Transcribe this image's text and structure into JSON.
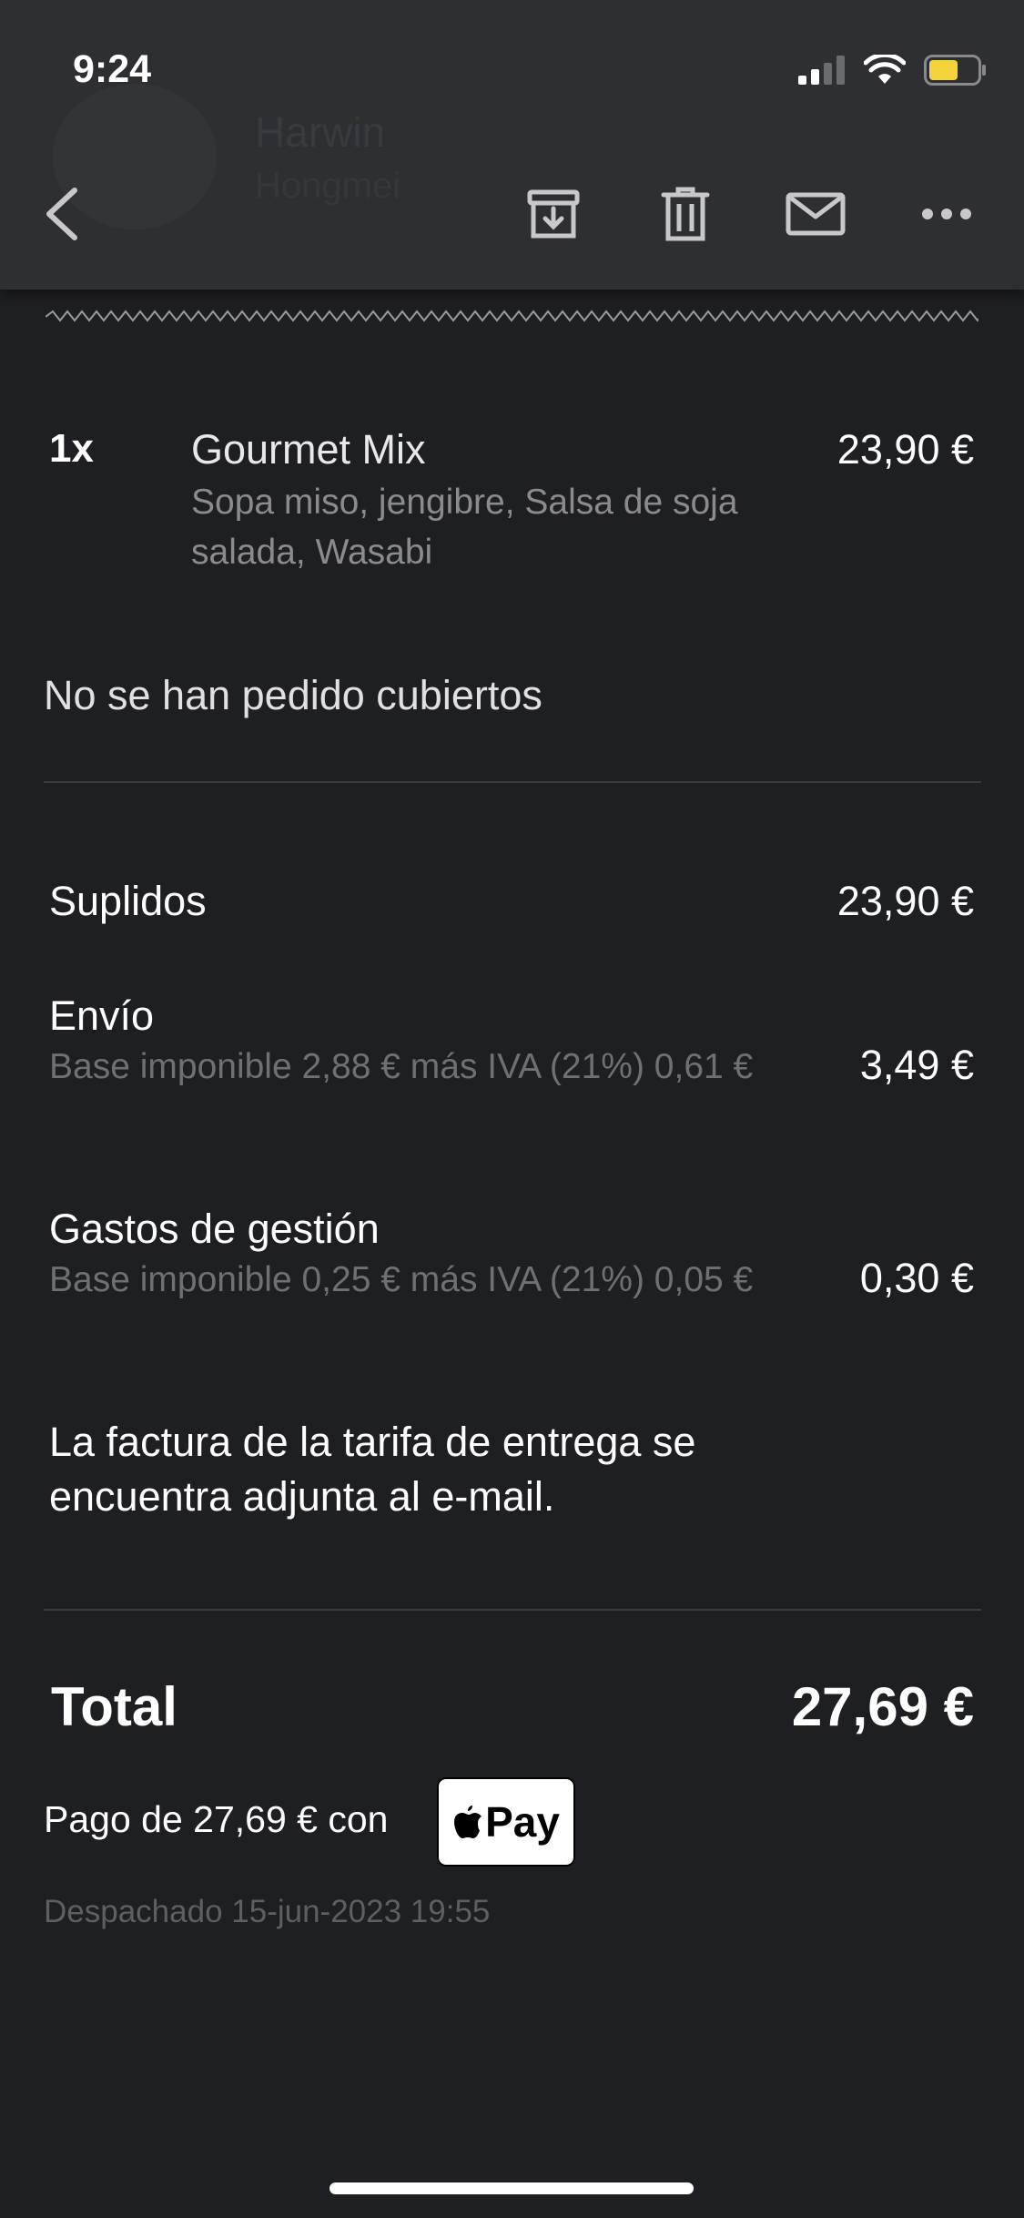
{
  "status_bar": {
    "time": "9:24"
  },
  "header": {
    "sender_name": "Harwin",
    "sender_sub": "Hongmei",
    "icons": [
      "back-icon",
      "archive-icon",
      "trash-icon",
      "mail-icon",
      "more-icon"
    ]
  },
  "order": {
    "items": [
      {
        "qty": "1x",
        "name": "Gourmet Mix",
        "description": "Sopa miso, jengibre, Salsa de soja salada, Wasabi",
        "price": "23,90 €"
      }
    ],
    "cutlery_note": "No se han pedido cubiertos"
  },
  "summary": {
    "suplidos": {
      "label": "Suplidos",
      "value": "23,90 €"
    },
    "envio": {
      "label": "Envío",
      "detail": "Base imponible 2,88 € más IVA (21%) 0,61 €",
      "value": "3,49 €"
    },
    "gastos": {
      "label": "Gastos de gestión",
      "detail": "Base imponible 0,25 € más IVA (21%) 0,05 €",
      "value": "0,30 €"
    },
    "invoice_note": "La factura de la tarifa de entrega se encuentra adjunta al e-mail."
  },
  "total": {
    "label": "Total",
    "value": "27,69 €"
  },
  "payment": {
    "text": "Pago de 27,69 € con",
    "method": "Pay"
  },
  "dispatched": "Despachado 15-jun-2023 19:55",
  "colors": {
    "background": "#1e1f22",
    "toolbar": "#2e2f33",
    "battery": "#f5d33c"
  }
}
